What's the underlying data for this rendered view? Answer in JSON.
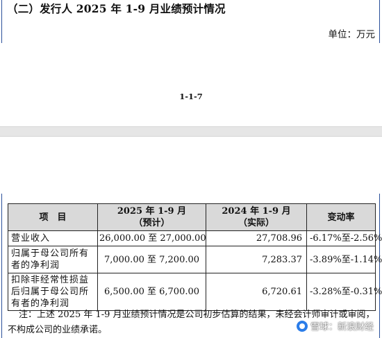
{
  "heading": "（二）发行人 2025 年 1-9 月业绩预计情况",
  "unit": "单位：万元",
  "page_number": "1-1-7",
  "table": {
    "headers": {
      "item": "项　目",
      "est_line1": "2025 年 1-9 月",
      "est_line2": "（预计）",
      "act_line1": "2024 年 1-9 月",
      "act_line2": "（实际）",
      "change": "变动率"
    },
    "rows": [
      {
        "item": "营业收入",
        "estimate": "26,000.00 至 27,000.00",
        "actual": "27,708.96",
        "change": "-6.17%至-2.56%"
      },
      {
        "item": "归属于母公司所有者的净利润",
        "estimate": "7,000.00 至 7,200.00",
        "actual": "7,283.37",
        "change": "-3.89%至-1.14%"
      },
      {
        "item": "扣除非经常性损益后归属于母公司所有者的净利润",
        "estimate": "6,500.00 至 6,700.00",
        "actual": "6,720.61",
        "change": "-3.28%至-0.31%"
      }
    ]
  },
  "note": "注：上述 2025 年 1-9 月业绩预计情况是公司初步估算的结果，未经会计师审计或审阅，不构成公司的业绩承诺。",
  "watermark": "雪球：新浪财经"
}
